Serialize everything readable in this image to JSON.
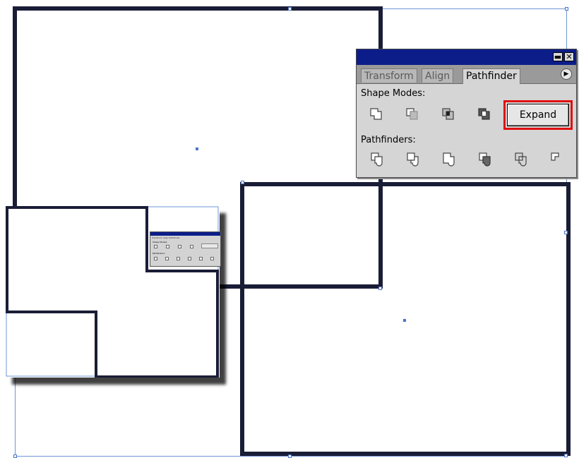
{
  "canvas": {
    "artwork_shapes": [
      "top-left-square",
      "bottom-right-square"
    ],
    "stroke_color": "#1a1d36",
    "selection_color": "#4a74c9"
  },
  "pathfinder_panel": {
    "tabs": [
      {
        "label": "Transform",
        "active": false
      },
      {
        "label": "Align",
        "active": false
      },
      {
        "label": "Pathfinder",
        "active": true
      }
    ],
    "shape_modes_label": "Shape Modes:",
    "shape_mode_icons": [
      "add-to-shape-area-icon",
      "subtract-from-shape-area-icon",
      "intersect-shape-areas-icon",
      "exclude-overlapping-shape-areas-icon"
    ],
    "expand_label": "Expand",
    "pathfinders_label": "Pathfinders:",
    "pathfinder_icons": [
      "divide-icon",
      "trim-icon",
      "merge-icon",
      "crop-icon",
      "outline-icon",
      "minus-back-icon"
    ],
    "highlight_color": "#e01010",
    "titlebar_color": "#0c1d8a"
  },
  "inset_preview": {
    "mini_tabs": "Transform Align Pathfinder",
    "mini_shape_modes_label": "Shape Modes:",
    "mini_pathfinders_label": "Pathfinders:"
  }
}
